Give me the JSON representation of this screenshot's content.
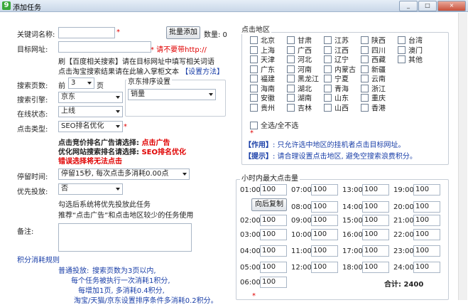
{
  "window": {
    "title": "添加任务",
    "app_icon_glyph": "9",
    "controls": [
      "_",
      "□",
      "×"
    ]
  },
  "form": {
    "keyword_label": "关键词名称:",
    "keyword_value": "",
    "batch_add_button": "批量添加",
    "count_label": "数量: 0",
    "target_url_label": "目标网址:",
    "target_url_value": "",
    "target_url_hint": "* 请不要带http://",
    "hint_line1": "刷【百度相关搜索】请在目标网址中填写相关词语",
    "hint_line2_prefix": "点击淘宝搜索结果请在此输入掌柜文本",
    "hint_line2_link": "【设置方法】",
    "search_pages_label": "搜索页数:",
    "search_pages_prefix": "前",
    "search_pages_value": "3",
    "search_pages_suffix": "页",
    "engine_label": "搜索引擎:",
    "engine_value": "京东",
    "online_label": "在线状态:",
    "online_value": "上线",
    "click_type_label": "点击类型:",
    "click_type_value": "SEO排名优化",
    "jd_sort_title": "京东排序设置",
    "jd_sort_value": "销量",
    "notice1_prefix": "点击竞价排名广告请选择:",
    "notice1_value": "点击广告",
    "notice2_prefix": "优化网站搜索排名请选择:",
    "notice2_value": "SEO排名优化",
    "notice3": "错误选择将无法点击",
    "stay_label": "停留时间:",
    "stay_value": "停留15秒, 每次点击多消耗0.00点",
    "priority_label": "优先投放:",
    "priority_value": "否",
    "priority_hint1": "勾选后系统将优先投放此任务",
    "priority_hint2": "推荐“点击广告”和点击地区较少的任务使用",
    "remark_label": "备注:",
    "remark_value": ""
  },
  "rules": {
    "title": "积分消耗规则",
    "label": "普通投放:",
    "line1": "搜索页数为3页以内,",
    "line2": "每个任务被执行一次消耗1积分,",
    "line3": "每增加1页, 多消耗0.4积分,",
    "line4": "淘宝/天猫/京东设置排序条件多消耗0.2积分。"
  },
  "regions": {
    "title": "点击地区",
    "items": [
      "北京",
      "甘肃",
      "江苏",
      "陕西",
      "台湾",
      "上海",
      "广西",
      "江西",
      "四川",
      "澳门",
      "天津",
      "河北",
      "辽宁",
      "西藏",
      "其他",
      "广东",
      "河南",
      "内蒙古",
      "新疆",
      "",
      "福建",
      "黑龙江",
      "宁夏",
      "云南",
      "",
      "海南",
      "湖北",
      "青海",
      "浙江",
      "",
      "安徽",
      "湖南",
      "山东",
      "重庆",
      "",
      "贵州",
      "吉林",
      "山西",
      "香港",
      ""
    ],
    "select_all_label": "全选/全不选",
    "asterisk": "*",
    "note1_label": "【作用】",
    "note1_text": ": 只允许选中地区的挂机者点击目标网址。",
    "note2_label": "【提示】",
    "note2_text": ": 请合理设置点击地区, 避免空搜索浪费积分。"
  },
  "hourly": {
    "title": "小时内最大点击量",
    "copy_button": "向后复制",
    "total_label": "合计: 2400",
    "hours": [
      {
        "t": "01:00",
        "v": "100"
      },
      {
        "t": "07:00",
        "v": "100"
      },
      {
        "t": "13:00",
        "v": "100"
      },
      {
        "t": "19:00",
        "v": "100"
      },
      {
        "t": "",
        "v": ""
      },
      {
        "t": "08:00",
        "v": "100"
      },
      {
        "t": "14:00",
        "v": "100"
      },
      {
        "t": "20:00",
        "v": "100"
      },
      {
        "t": "02:00",
        "v": "100"
      },
      {
        "t": "09:00",
        "v": "100"
      },
      {
        "t": "15:00",
        "v": "100"
      },
      {
        "t": "21:00",
        "v": "100"
      },
      {
        "t": "03:00",
        "v": "100"
      },
      {
        "t": "10:00",
        "v": "100"
      },
      {
        "t": "16:00",
        "v": "100"
      },
      {
        "t": "22:00",
        "v": "100"
      },
      {
        "t": "04:00",
        "v": "100"
      },
      {
        "t": "11:00",
        "v": "100"
      },
      {
        "t": "17:00",
        "v": "100"
      },
      {
        "t": "23:00",
        "v": "100"
      },
      {
        "t": "05:00",
        "v": "100"
      },
      {
        "t": "12:00",
        "v": "100"
      },
      {
        "t": "18:00",
        "v": "100"
      },
      {
        "t": "24:00",
        "v": "100"
      },
      {
        "t": "06:00",
        "v": "100"
      }
    ],
    "bottom_asterisk": "*"
  },
  "colors": {
    "accent_red": "#e00000",
    "accent_blue": "#1a3fa8"
  }
}
